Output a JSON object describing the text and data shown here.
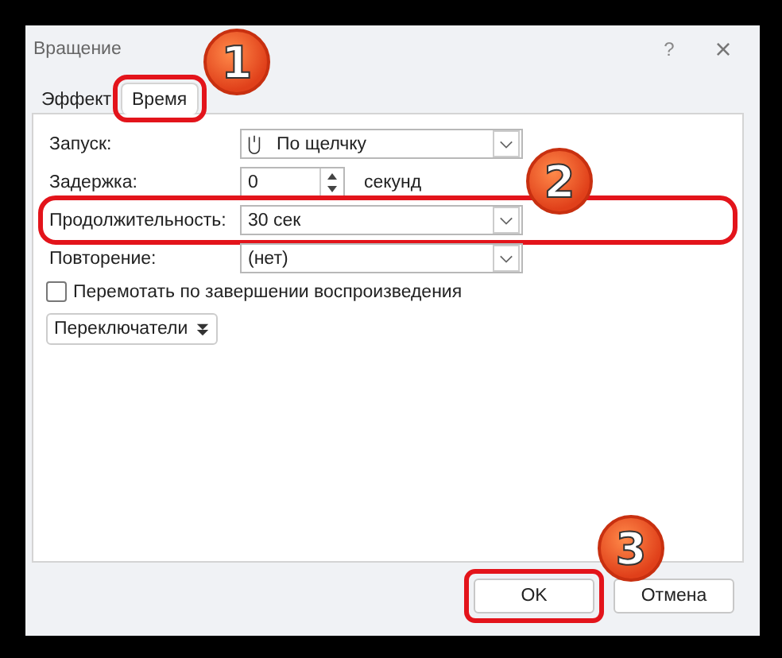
{
  "window": {
    "title": "Вращение",
    "help": "?",
    "close": "×"
  },
  "tabs": [
    {
      "label": "Эффект",
      "selected": false,
      "highlighted": false
    },
    {
      "label": "Время",
      "selected": true,
      "highlighted": true
    }
  ],
  "fields": [
    {
      "label": "Запуск:",
      "kind": "dropdown",
      "value": "По щелчку",
      "highlighted": false
    },
    {
      "label": "Задержка:",
      "kind": "spinner",
      "value": "0",
      "unit": "секунд",
      "highlighted": false
    },
    {
      "label": "Продолжительность:",
      "kind": "dropdown",
      "value": "30 сек",
      "highlighted": true
    },
    {
      "label": "Повторение:",
      "kind": "dropdown",
      "value": "(нет)",
      "highlighted": false
    }
  ],
  "rewind_checkbox": {
    "label": "Перемотать по завершении воспроизведения",
    "checked": false
  },
  "triggers_button": {
    "label": "Переключатели"
  },
  "buttons": [
    {
      "label": "OK",
      "highlighted": true
    },
    {
      "label": "Отмена",
      "highlighted": false
    }
  ],
  "callouts": [
    "1",
    "2",
    "3"
  ]
}
